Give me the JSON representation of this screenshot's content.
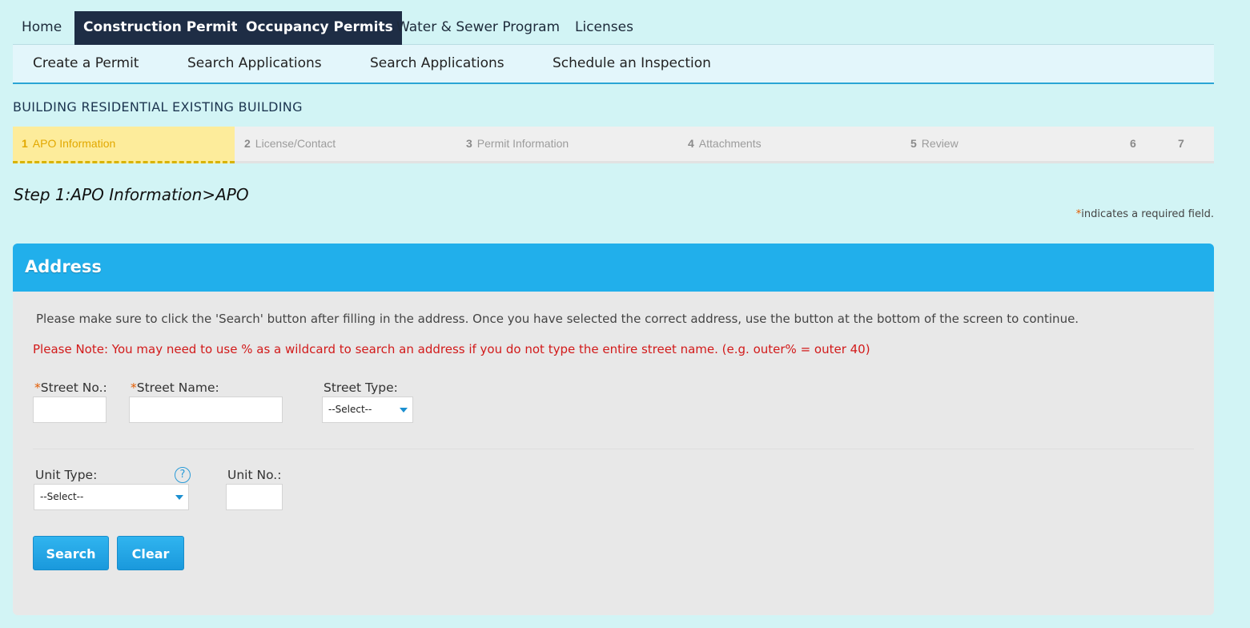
{
  "topnav": {
    "items": [
      "Home",
      "Construction Permits",
      "Occupancy Permits",
      "Water & Sewer Program",
      "Licenses"
    ],
    "active": "Construction Permits"
  },
  "subnav": {
    "items": [
      "Create a Permit",
      "Search Applications",
      "Search Applications",
      "Schedule an Inspection"
    ]
  },
  "record_type": "BUILDING RESIDENTIAL EXISTING BUILDING",
  "steps": [
    {
      "num": "1",
      "label": "APO Information"
    },
    {
      "num": "2",
      "label": "License/Contact"
    },
    {
      "num": "3",
      "label": "Permit Information"
    },
    {
      "num": "4",
      "label": "Attachments"
    },
    {
      "num": "5",
      "label": "Review"
    },
    {
      "num": "6",
      "label": ""
    },
    {
      "num": "7",
      "label": ""
    }
  ],
  "step_title": "Step 1:APO Information>APO",
  "required_note": {
    "star": "*",
    "text": "indicates a required field."
  },
  "address": {
    "title": "Address",
    "instructions": "Please make sure to click the 'Search' button after filling in the address. Once you have selected the correct address, use the button at the bottom of the screen to continue.",
    "note": "Please Note: You may need to use % as a wildcard to search an address if you do not type the entire street name. (e.g. outer% = outer 40)",
    "street_no_label": "Street No.:",
    "street_name_label": "Street Name:",
    "street_type_label": "Street Type:",
    "street_type_value": "--Select--",
    "unit_type_label": "Unit Type:",
    "unit_type_value": "--Select--",
    "unit_no_label": "Unit No.:",
    "help_glyph": "?",
    "search_label": "Search",
    "clear_label": "Clear"
  },
  "colors": {
    "page_bg": "#d2f4f5",
    "nav_dark": "#1e2d45",
    "panel_header": "#21afeb",
    "active_step_bg": "#fdec9b",
    "note_red": "#d21a1a",
    "required_star": "#e35b00"
  }
}
